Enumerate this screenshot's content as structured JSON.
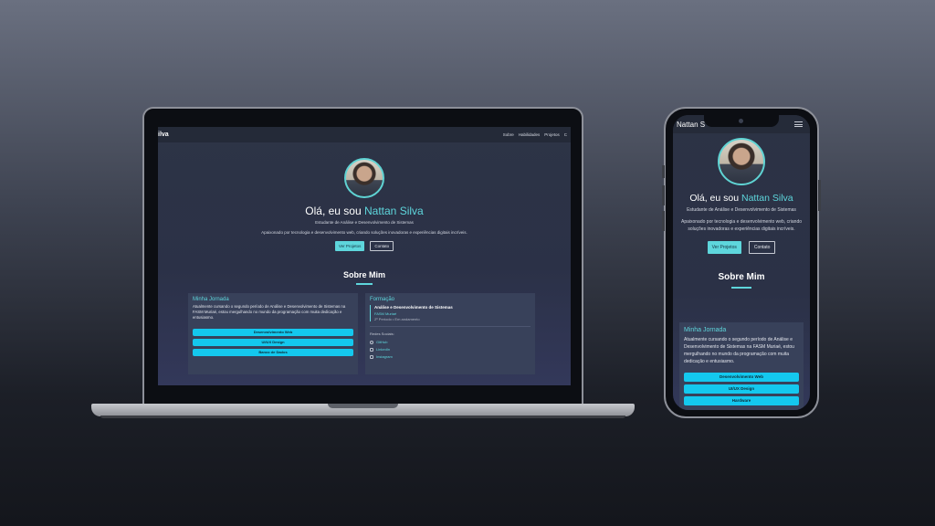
{
  "site": {
    "brand": "Nattan Silva",
    "brand_laptop_visible": "ilva",
    "brand_phone_visible": "Nattan S",
    "nav": [
      "Sobre",
      "Habilidades",
      "Projetos",
      "C"
    ]
  },
  "hero": {
    "greeting": "Olá, eu sou ",
    "name": "Nattan Silva",
    "subtitle": "Estudante de Análise e Desenvolvimento de Sistemas",
    "description": "Apaixonado por tecnologia e desenvolvimento web, criando soluções inovadoras e experiências digitais incríveis.",
    "primary_button": "Ver Projetos",
    "secondary_button": "Contato"
  },
  "about": {
    "heading": "Sobre Mim",
    "journey": {
      "title": "Minha Jornada",
      "text": "Atualmente cursando o segundo período de Análise e Desenvolvimento de Sistemas na FASM Muriaé, estou mergulhando no mundo da programação com muita dedicação e entusiasmo.",
      "skills": [
        "Desenvolvimento Web",
        "UI/UX Design",
        "Banco de Dados"
      ],
      "skills_mobile": [
        "Desenvolvimento Web",
        "UI/UX Design",
        "Hardware"
      ]
    },
    "education": {
      "title": "Formação",
      "course": "Análise e Desenvolvimento de Sistemas",
      "school": "FASM Muriaé",
      "status": "2º Período • Em andamento"
    },
    "social": {
      "title": "Redes Sociais:",
      "links": [
        "GitHub",
        "LinkedIn",
        "Instagram"
      ]
    }
  },
  "colors": {
    "accent": "#5ed6dc",
    "pill": "#14c8ee",
    "card": "#38415a"
  }
}
